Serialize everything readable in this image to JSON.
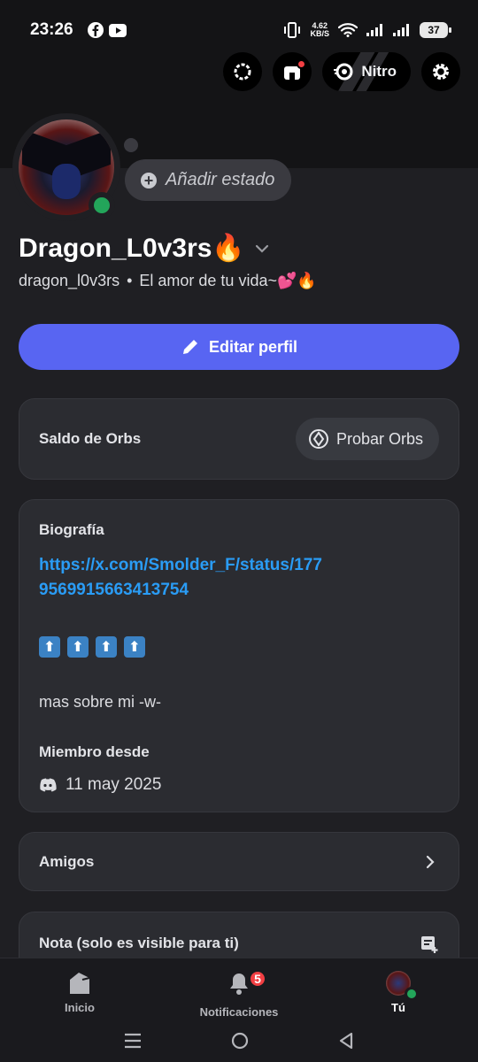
{
  "status_bar": {
    "time": "23:26",
    "net_speed_value": "4.62",
    "net_speed_unit": "KB/S",
    "battery": "37",
    "icons": [
      "facebook-icon",
      "youtube-icon",
      "vibrate-icon",
      "wifi-icon",
      "signal-icon",
      "signal-icon",
      "battery-icon"
    ]
  },
  "top_actions": {
    "nitro_label": "Nitro"
  },
  "profile": {
    "status_placeholder": "Añadir estado",
    "display_name": "Dragon_L0v3rs🔥",
    "username": "dragon_l0v3rs",
    "separator": "•",
    "pronoun_tagline": "El amor de tu vida~💕🔥",
    "online_color": "#23a55a"
  },
  "edit_button": {
    "label": "Editar perfil",
    "color": "#5865f2"
  },
  "orbs_card": {
    "title": "Saldo de Orbs",
    "button_label": "Probar Orbs"
  },
  "bio_card": {
    "title": "Biografía",
    "link": "https://x.com/Smolder_F/status/1779569915663413754",
    "arrows": [
      "⬆",
      "⬆",
      "⬆",
      "⬆"
    ],
    "text": "mas sobre mi -w-",
    "member_since_title": "Miembro desde",
    "member_since_date": "11 may 2025"
  },
  "friends_card": {
    "title": "Amigos"
  },
  "note_card": {
    "title": "Nota (solo es visible para ti)"
  },
  "tab_bar": {
    "tabs": [
      {
        "label": "Inicio",
        "icon": "home-icon"
      },
      {
        "label": "Notificaciones",
        "icon": "bell-icon",
        "badge": "5"
      },
      {
        "label": "Tú",
        "icon": "avatar"
      }
    ]
  }
}
